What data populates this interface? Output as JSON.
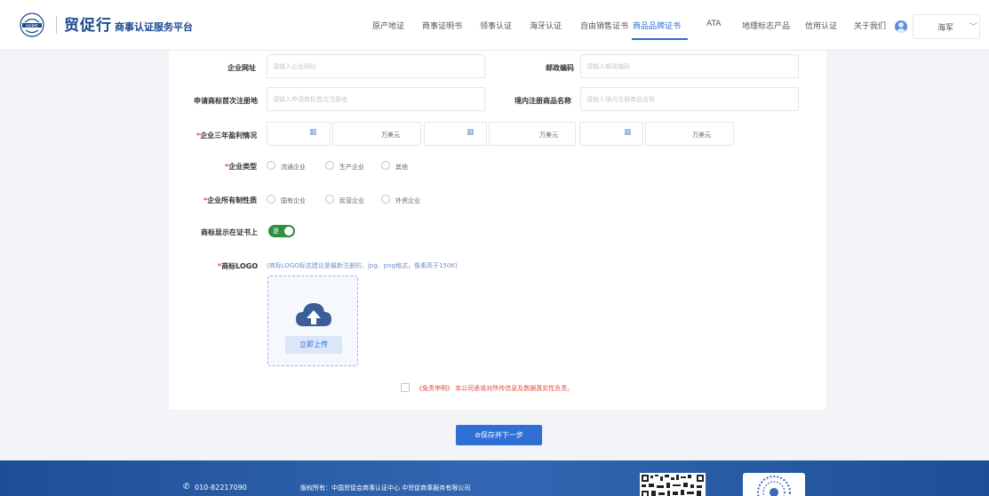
{
  "header": {
    "brand_main": "贸促行",
    "brand_sub": "商事认证服务平台",
    "nav": [
      {
        "label": "原产地证",
        "active": false
      },
      {
        "label": "商事证明书",
        "active": false
      },
      {
        "label": "领事认证",
        "active": false
      },
      {
        "label": "海牙认证",
        "active": false
      },
      {
        "label": "自由销售证书",
        "active": false
      },
      {
        "label": "商品品牌证书",
        "active": true
      },
      {
        "label": "ATA",
        "active": false
      },
      {
        "label": "地理标志产品",
        "active": false
      },
      {
        "label": "信用认证",
        "active": false
      },
      {
        "label": "关于我们",
        "active": false
      }
    ],
    "user": "海军"
  },
  "form": {
    "website": {
      "label": "企业网址",
      "placeholder": "请输入企业网址"
    },
    "postcode": {
      "label": "邮政编码",
      "placeholder": "请输入邮政编码"
    },
    "first_reg": {
      "label": "申请商标首次注册地",
      "placeholder": "请输入申请商标首次注册地"
    },
    "domestic_name": {
      "label": "境内注册商品名称",
      "placeholder": "请输入境内注册商品名称"
    },
    "profit": {
      "required_mark": "*",
      "label": "企业三年盈利情况",
      "unit": "万美元"
    },
    "company_type": {
      "required_mark": "*",
      "label": "企业类型",
      "options": [
        "流通企业",
        "生产企业",
        "其他"
      ]
    },
    "ownership": {
      "required_mark": "*",
      "label": "企业所有制性质",
      "options": [
        "国有企业",
        "民营企业",
        "外资企业"
      ]
    },
    "show_trademark": {
      "label": "商标显示在证书上",
      "toggle_text": "是",
      "on": true
    },
    "logo": {
      "required_mark": "*",
      "label": "商标LOGO",
      "hint": "(商标LOGO标志建议是最新注册的，jpg、png格式，像素高于150K)",
      "upload_label": "立即上传"
    },
    "agreement": {
      "link": "《免责申明》",
      "text": "本公司承诺对所传信息及数据真实性负责。"
    }
  },
  "save_button": "⊘保存并下一步",
  "footer": {
    "phone": "010-82217090",
    "copyright": "版权所有：中国贸促会商事认证中心 中贸促商事服务有限公司"
  },
  "colors": {
    "primary": "#2f6fd6",
    "brand": "#1b4a8f",
    "required": "#e24b3b",
    "toggle": "#2e8f3f",
    "footer": "#2a5ea8"
  }
}
